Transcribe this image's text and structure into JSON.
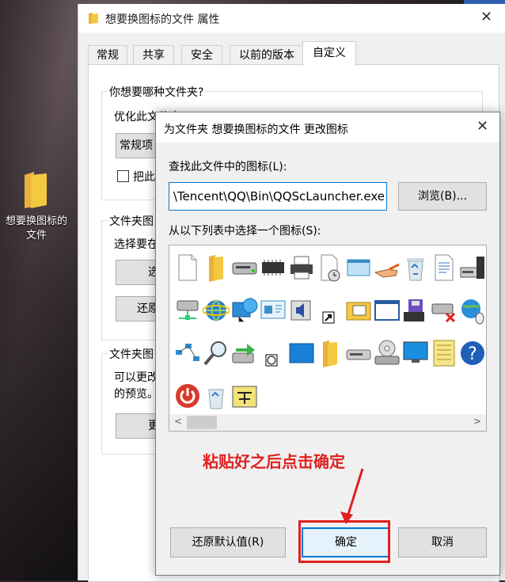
{
  "desktop": {
    "icon_label": "想要换图标的\n文件",
    "icon_label_line1": "想要换图标的",
    "icon_label_line2": "文件"
  },
  "properties": {
    "title": "想要换图标的文件 属性",
    "tabs": [
      {
        "label": "常规"
      },
      {
        "label": "共享"
      },
      {
        "label": "安全"
      },
      {
        "label": "以前的版本"
      },
      {
        "label": "自定义"
      }
    ],
    "group1_title": "你想要哪种文件夹?",
    "optimize_label": "优化此文件夹(T):",
    "optimize_value": "常规项",
    "apply_sub_label": "把此",
    "group2_title": "文件夹图",
    "choose_text": "选择要在",
    "choose_btn": "选",
    "restore_btn": "还原",
    "group3_title": "文件夹图",
    "desc_line1": "可以更改",
    "desc_line2": "的预览。",
    "change_btn": "更"
  },
  "dialog": {
    "title": "为文件夹 想要换图标的文件 更改图标",
    "find_label": "查找此文件中的图标(L):",
    "path_value": "\\Tencent\\QQ\\Bin\\QQScLauncher.exe",
    "browse_btn": "浏览(B)...",
    "select_label": "从以下列表中选择一个图标(S):",
    "restore_default_btn": "还原默认值(R)",
    "ok_btn": "确定",
    "cancel_btn": "取消"
  },
  "icons": [
    "blank-file-icon",
    "folder-icon",
    "hard-drive-icon",
    "memory-chip-icon",
    "printer-icon",
    "clock-file-icon",
    "window-3d-icon",
    "hand-pointer-icon",
    "recycle-bin-full-icon",
    "text-document-icon",
    "computer-tower-icon",
    "network-drive-icon",
    "globe-ie-icon",
    "network-globe-icon",
    "presentation-icon",
    "speaker-window-icon",
    "shortcut-arrow-icon",
    "folder-tools-icon",
    "window-frame-icon",
    "floppy-disk-icon",
    "disconnected-drive-icon",
    "globe-mouse-icon",
    "network-nodes-icon",
    "magnifier-icon",
    "drive-arrow-icon",
    "clock-small-icon",
    "blue-window-icon",
    "folder-icon-2",
    "flat-drive-icon",
    "cd-drive-icon",
    "monitor-icon",
    "notes-icon",
    "help-icon",
    "power-icon",
    "recycle-bin-icon",
    "network-cable-icon"
  ],
  "annotation": {
    "text": "粘贴好之后点击确定",
    "color": "#e02020"
  },
  "colors": {
    "accent": "#0078d7",
    "annotation": "#e02020",
    "folder": "#f5c842"
  }
}
